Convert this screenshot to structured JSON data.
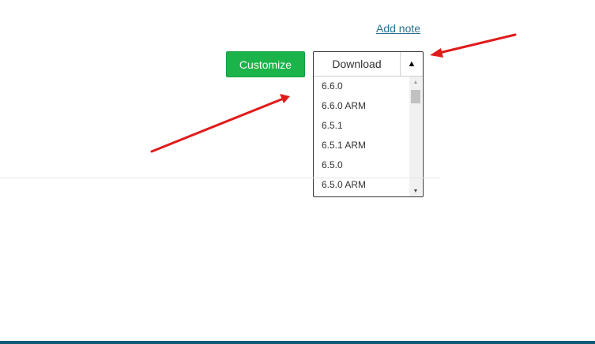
{
  "add_note": {
    "label": "Add note"
  },
  "toolbar": {
    "customize_label": "Customize"
  },
  "download": {
    "label": "Download",
    "toggle_icon": "triangle-up-icon",
    "versions": [
      "6.6.0",
      "6.6.0 ARM",
      "6.5.1",
      "6.5.1 ARM",
      "6.5.0",
      "6.5.0 ARM"
    ]
  },
  "colors": {
    "customize_bg": "#1bb44a",
    "link": "#2a6f8f",
    "annotation_arrow": "#e01b1b",
    "footer_bar": "#0f5d75"
  }
}
